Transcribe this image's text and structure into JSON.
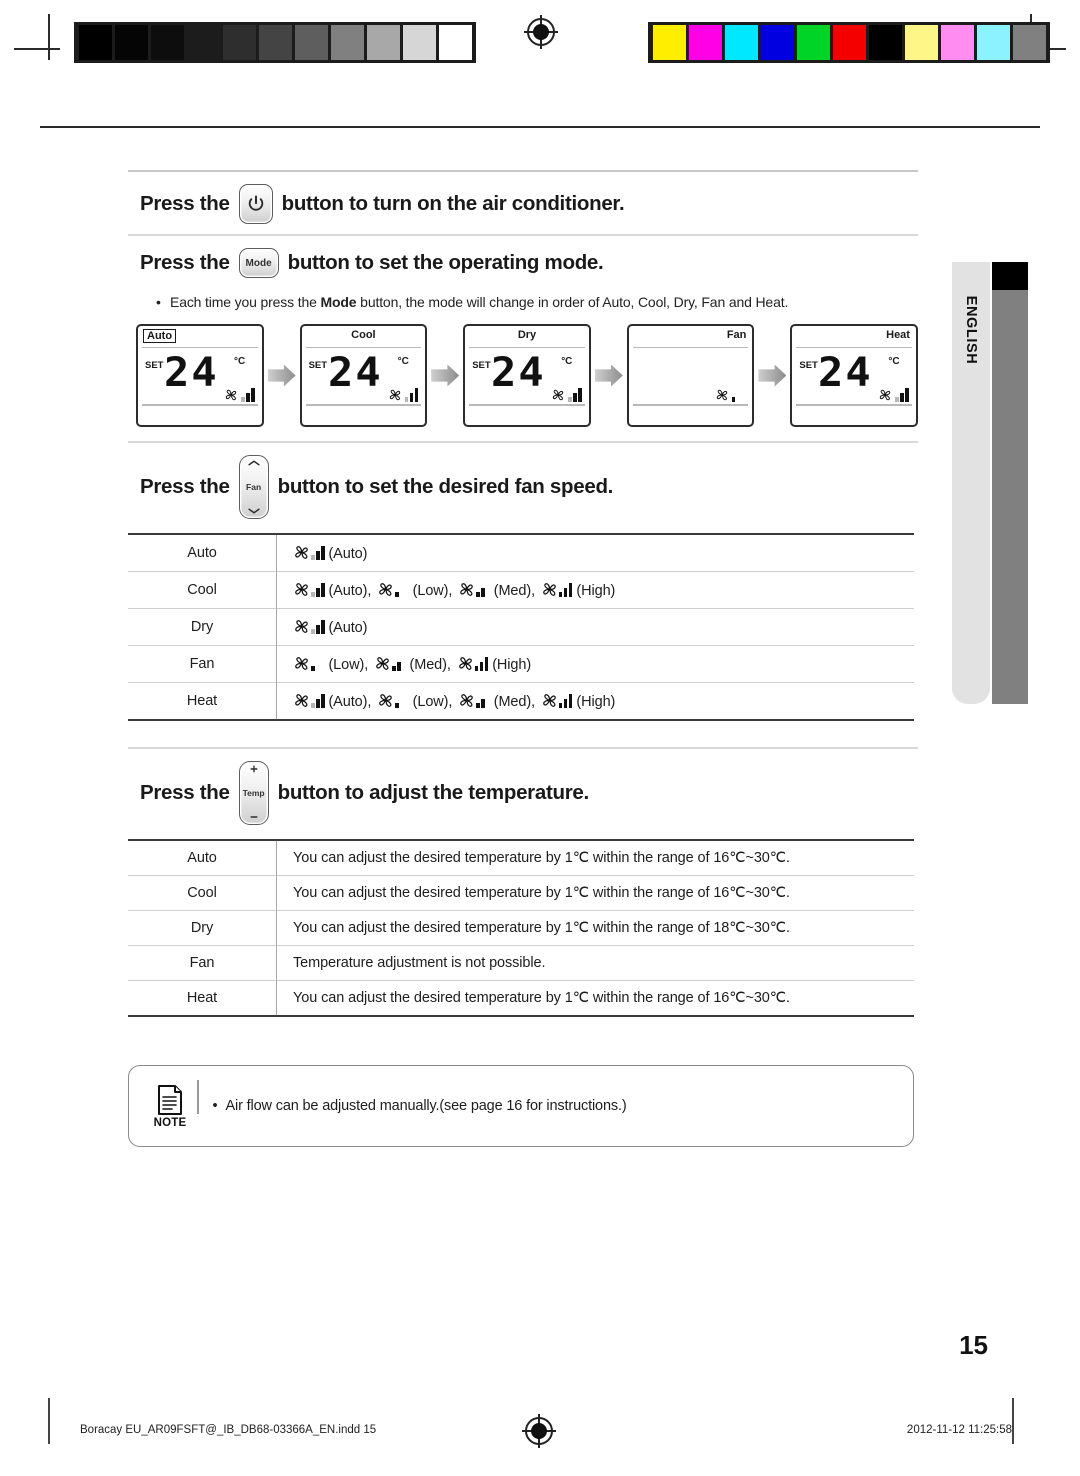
{
  "calibration": {
    "grayscale": [
      "#000000",
      "#050505",
      "#0d0d0d",
      "#1c1c1c",
      "#2e2e2e",
      "#444444",
      "#5e5e5e",
      "#808080",
      "#a8a8a8",
      "#d6d6d6",
      "#ffffff"
    ],
    "colors": [
      "#ffee00",
      "#ff00e6",
      "#00e8ff",
      "#0000e0",
      "#00d426",
      "#f40000",
      "#000000",
      "#fff688",
      "#ff8cf0",
      "#8cf2ff",
      "#808080"
    ]
  },
  "instructions": {
    "power": {
      "pre": "Press the",
      "post": "button to turn on the air conditioner.",
      "icon": "power-icon"
    },
    "mode": {
      "pre": "Press the",
      "post": "button to set the operating mode.",
      "key_label": "Mode",
      "bullet": {
        "lead": "Each time you press the ",
        "bold": "Mode",
        "tail": " button, the mode will change in order of Auto, Cool, Dry, Fan and Heat."
      }
    },
    "fan": {
      "pre": "Press the",
      "post": "button to set the desired fan speed.",
      "key_label": "Fan",
      "up_icon": "chevron-up-icon",
      "down_icon": "chevron-down-icon"
    },
    "temp": {
      "pre": "Press the",
      "post": "button to adjust the temperature.",
      "key_label": "Temp",
      "plus_icon": "plus-icon",
      "minus_icon": "minus-icon"
    }
  },
  "lcd_sequence": [
    {
      "mode": "Auto",
      "label_style": "boxed",
      "set": "SET",
      "value": "24",
      "unit": "°C",
      "show_temp": true,
      "fan_pattern": "auto"
    },
    {
      "mode": "Cool",
      "label_style": "center",
      "set": "SET",
      "value": "24",
      "unit": "°C",
      "show_temp": true,
      "fan_pattern": "auto"
    },
    {
      "mode": "Dry",
      "label_style": "center",
      "set": "SET",
      "value": "24",
      "unit": "°C",
      "show_temp": true,
      "fan_pattern": "auto"
    },
    {
      "mode": "Fan",
      "label_style": "right",
      "set": "",
      "value": "",
      "unit": "",
      "show_temp": false,
      "fan_pattern": "low"
    },
    {
      "mode": "Heat",
      "label_style": "right",
      "set": "SET",
      "value": "24",
      "unit": "°C",
      "show_temp": true,
      "fan_pattern": "auto"
    }
  ],
  "fan_speed_table": {
    "rows": [
      {
        "mode": "Auto",
        "options": [
          {
            "label": "(Auto)",
            "pattern": "auto"
          }
        ]
      },
      {
        "mode": "Cool",
        "options": [
          {
            "label": "(Auto)",
            "pattern": "auto"
          },
          {
            "label": "(Low)",
            "pattern": "low"
          },
          {
            "label": "(Med)",
            "pattern": "med"
          },
          {
            "label": "(High)",
            "pattern": "high"
          }
        ]
      },
      {
        "mode": "Dry",
        "options": [
          {
            "label": "(Auto)",
            "pattern": "auto"
          }
        ]
      },
      {
        "mode": "Fan",
        "options": [
          {
            "label": "(Low)",
            "pattern": "low"
          },
          {
            "label": "(Med)",
            "pattern": "med"
          },
          {
            "label": "(High)",
            "pattern": "high"
          }
        ]
      },
      {
        "mode": "Heat",
        "options": [
          {
            "label": "(Auto)",
            "pattern": "auto"
          },
          {
            "label": "(Low)",
            "pattern": "low"
          },
          {
            "label": "(Med)",
            "pattern": "med"
          },
          {
            "label": "(High)",
            "pattern": "high"
          }
        ]
      }
    ]
  },
  "temperature_table": {
    "rows": [
      {
        "mode": "Auto",
        "text": "You can adjust the desired temperature by 1℃ within the range of 16℃~30℃."
      },
      {
        "mode": "Cool",
        "text": "You can adjust the desired temperature by 1℃ within the range of 16℃~30℃."
      },
      {
        "mode": "Dry",
        "text": "You can adjust the desired temperature by 1℃ within the range of 18℃~30℃."
      },
      {
        "mode": "Fan",
        "text": "Temperature adjustment is not possible."
      },
      {
        "mode": "Heat",
        "text": "You can adjust the desired temperature by 1℃ within the range of 16℃~30℃."
      }
    ]
  },
  "note": {
    "label": "NOTE",
    "icon": "document-icon",
    "text": "Air flow can be adjusted manually.(see page 16 for instructions.)"
  },
  "side_tab": {
    "language": "ENGLISH"
  },
  "page_number": "15",
  "footer": {
    "file": "Boracay EU_AR09FSFT@_IB_DB68-03366A_EN.indd   15",
    "timestamp": "2012-11-12   11:25:58"
  }
}
